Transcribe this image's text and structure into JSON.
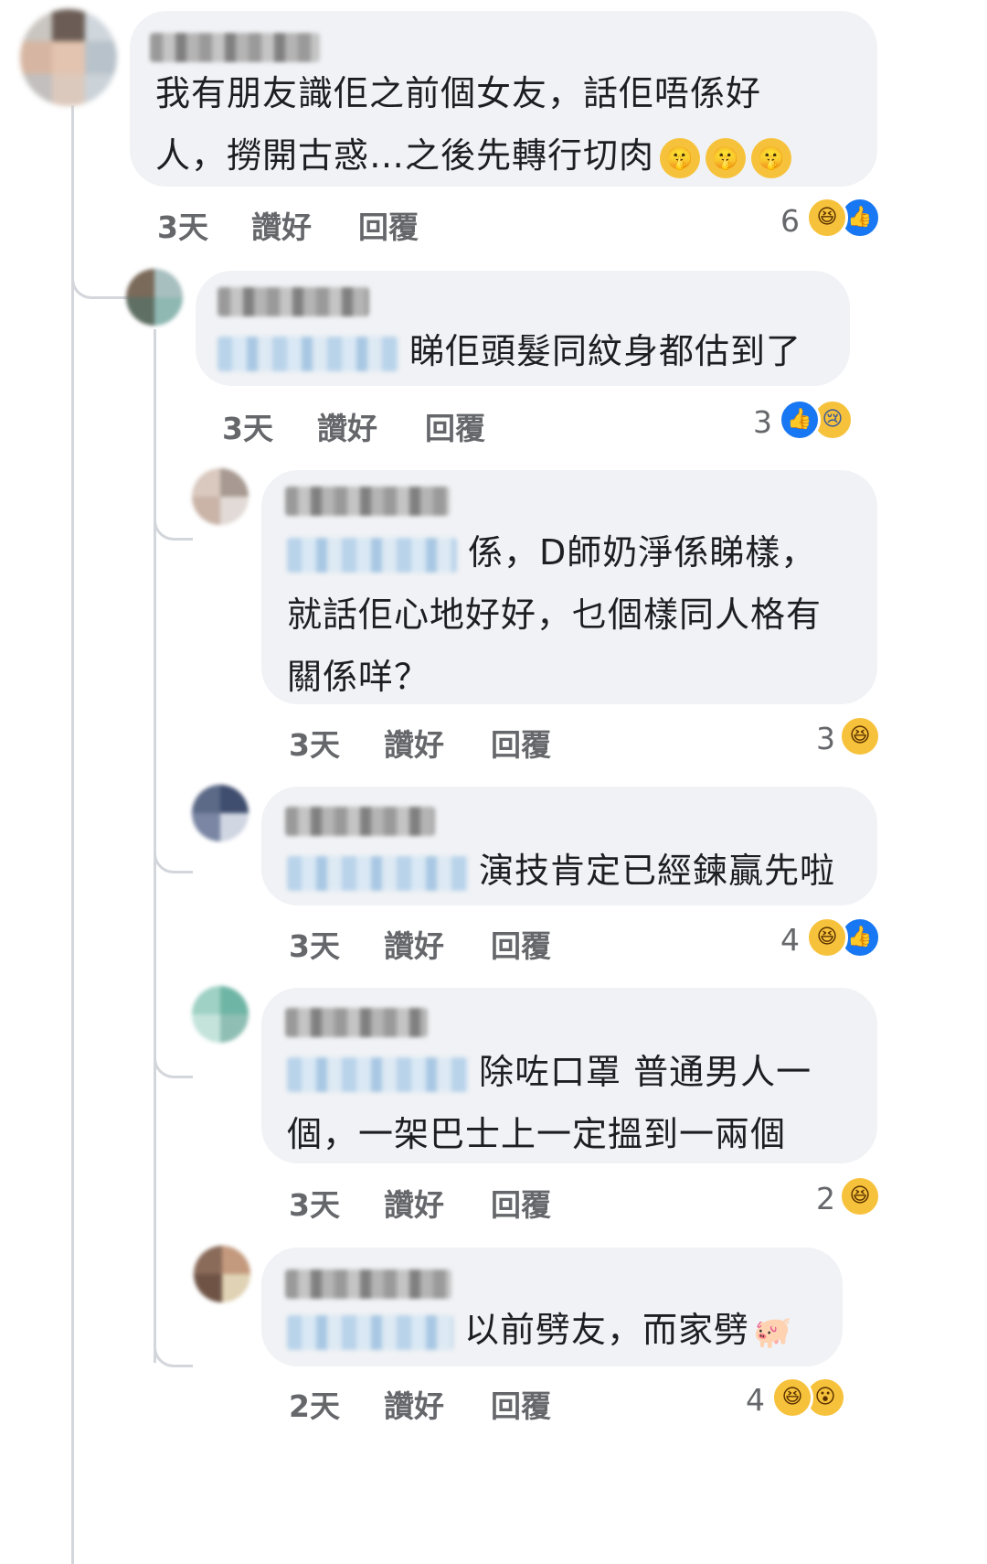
{
  "comments": [
    {
      "lines": [
        "我有朋友識佢之前個女友，話佢唔係好",
        "人，撈開古惑…之後先轉行切肉"
      ],
      "trailing_emoji_icons": [
        "shushing-face-icon",
        "shushing-face-icon",
        "shushing-face-icon"
      ],
      "time": "3天",
      "like": "讚好",
      "reply": "回覆",
      "reaction_count": "6",
      "reaction_icons": [
        "haha-icon",
        "like-icon"
      ]
    },
    {
      "lines": [
        "睇佢頭髮同紋身都估到了"
      ],
      "time": "3天",
      "like": "讚好",
      "reply": "回覆",
      "reaction_count": "3",
      "reaction_icons": [
        "like-icon",
        "sad-icon"
      ]
    },
    {
      "lines": [
        "係，D師奶淨係睇樣，",
        "就話佢心地好好，乜個樣同人格有",
        "關係咩？"
      ],
      "time": "3天",
      "like": "讚好",
      "reply": "回覆",
      "reaction_count": "3",
      "reaction_icons": [
        "haha-icon"
      ]
    },
    {
      "lines": [
        "演技肯定已經鍊贏先啦"
      ],
      "time": "3天",
      "like": "讚好",
      "reply": "回覆",
      "reaction_count": "4",
      "reaction_icons": [
        "haha-icon",
        "like-icon"
      ]
    },
    {
      "lines": [
        "除咗口罩 普通男人一",
        "個，一架巴士上一定搵到一兩個"
      ],
      "time": "3天",
      "like": "讚好",
      "reply": "回覆",
      "reaction_count": "2",
      "reaction_icons": [
        "haha-icon"
      ]
    },
    {
      "lines": [
        "以前劈友，而家劈"
      ],
      "trailing_emoji_icons": [
        "pig-icon"
      ],
      "time": "2天",
      "like": "讚好",
      "reply": "回覆",
      "reaction_count": "4",
      "reaction_icons": [
        "haha-icon",
        "wow-icon"
      ]
    }
  ]
}
